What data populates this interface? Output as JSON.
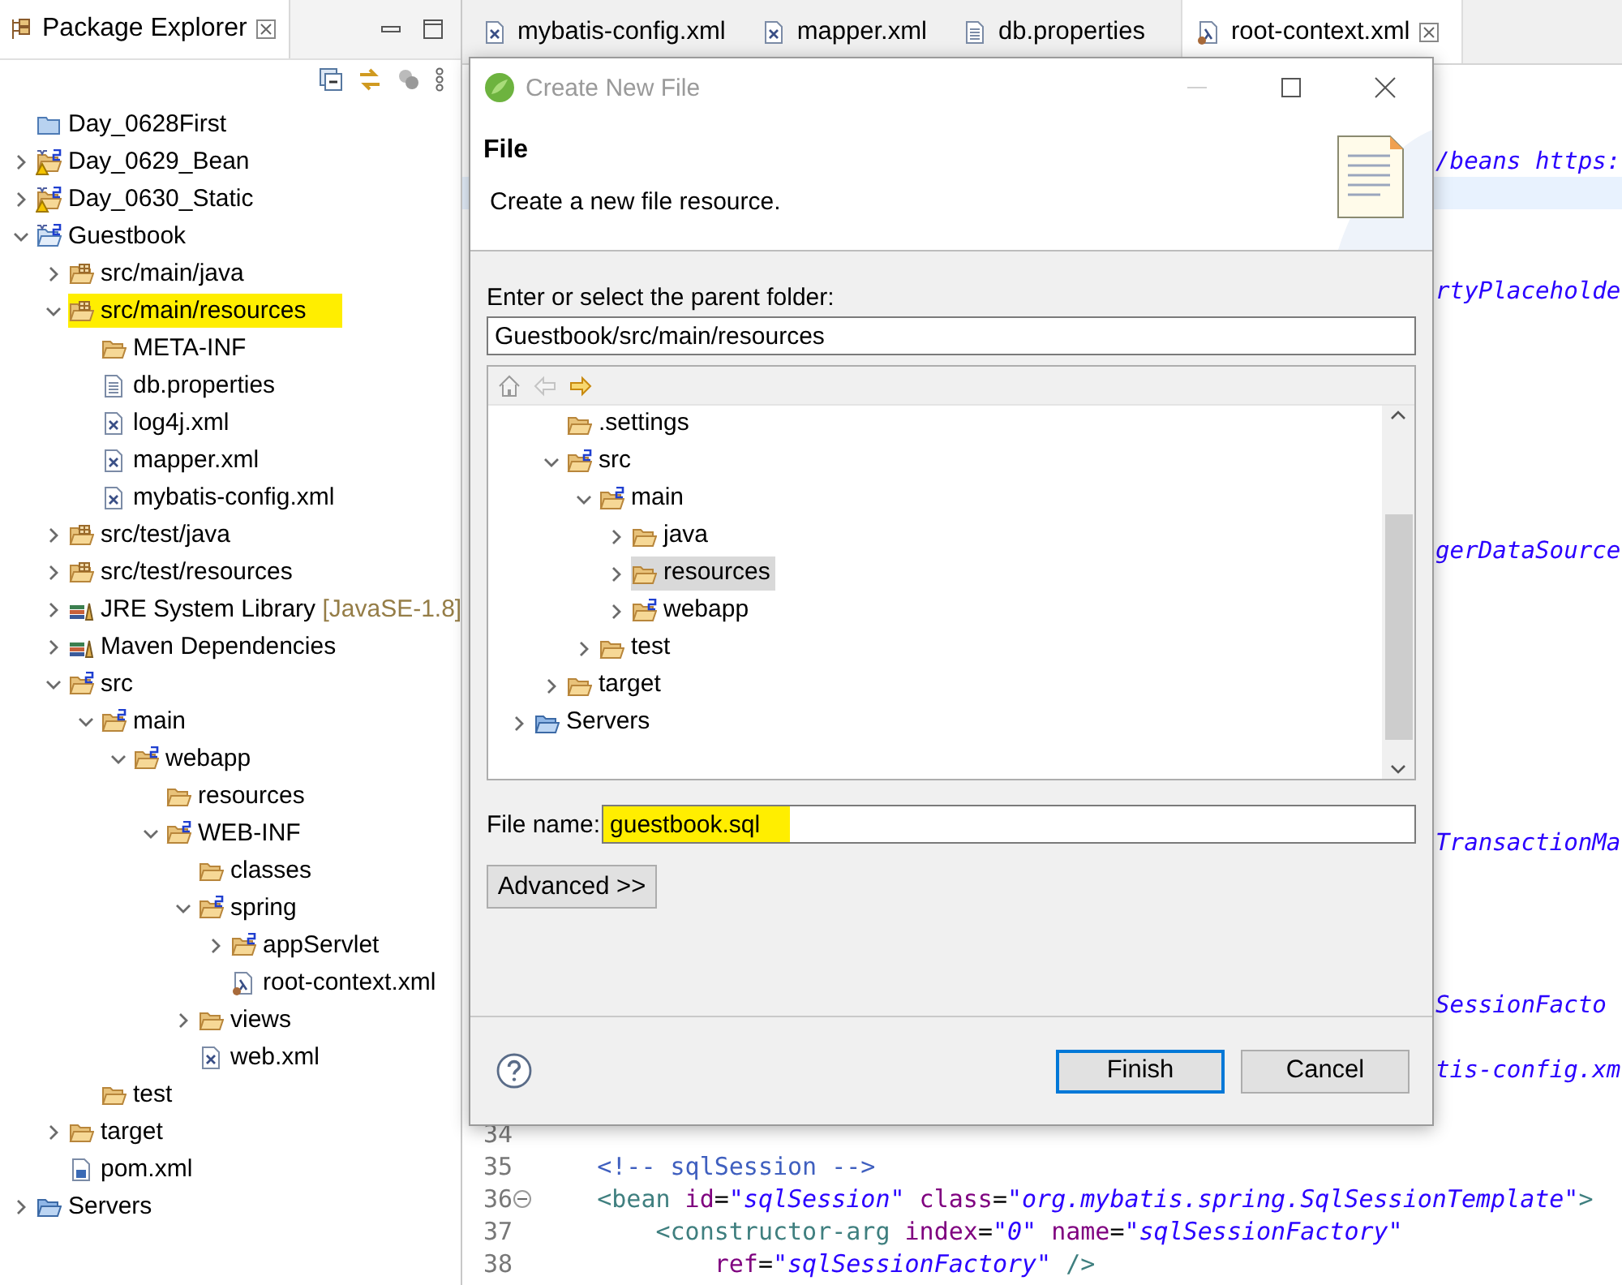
{
  "explorer": {
    "title": "Package Explorer",
    "items": [
      {
        "label": "Day_0628First",
        "kind": "project",
        "selected": false,
        "highlighted": false
      },
      {
        "label": "Day_0629_Bean",
        "kind": "maven-warn",
        "expanded": false,
        "selected": false,
        "highlighted": false
      },
      {
        "label": "Day_0630_Static",
        "kind": "maven-warn",
        "expanded": false,
        "selected": false,
        "highlighted": false
      },
      {
        "label": "Guestbook",
        "kind": "maven",
        "expanded": true,
        "selected": false,
        "highlighted": false,
        "children": [
          {
            "label": "src/main/java",
            "kind": "source-folder",
            "expanded": false,
            "selected": false,
            "highlighted": false
          },
          {
            "label": "src/main/resources",
            "kind": "source-folder",
            "expanded": true,
            "selected": true,
            "highlighted": true,
            "children": [
              {
                "label": "META-INF",
                "kind": "folder",
                "selected": false,
                "highlighted": false
              },
              {
                "label": "db.properties",
                "kind": "file",
                "selected": false,
                "highlighted": false
              },
              {
                "label": "log4j.xml",
                "kind": "xml",
                "selected": false,
                "highlighted": false
              },
              {
                "label": "mapper.xml",
                "kind": "xml",
                "selected": false,
                "highlighted": false
              },
              {
                "label": "mybatis-config.xml",
                "kind": "xml",
                "selected": false,
                "highlighted": false
              }
            ]
          },
          {
            "label": "src/test/java",
            "kind": "source-folder",
            "expanded": false,
            "selected": false,
            "highlighted": false
          },
          {
            "label": "src/test/resources",
            "kind": "source-folder",
            "expanded": false,
            "selected": false,
            "highlighted": false
          },
          {
            "label": "JRE System Library",
            "decoration": "[JavaSE-1.8]",
            "kind": "library",
            "expanded": false,
            "selected": false,
            "highlighted": false
          },
          {
            "label": "Maven Dependencies",
            "kind": "library",
            "expanded": false,
            "selected": false,
            "highlighted": false
          },
          {
            "label": "src",
            "kind": "spring-folder",
            "expanded": true,
            "selected": false,
            "highlighted": false,
            "children": [
              {
                "label": "main",
                "kind": "spring-folder",
                "expanded": true,
                "selected": false,
                "highlighted": false,
                "children": [
                  {
                    "label": "webapp",
                    "kind": "spring-folder",
                    "expanded": true,
                    "selected": false,
                    "highlighted": false,
                    "children": [
                      {
                        "label": "resources",
                        "kind": "folder",
                        "selected": false,
                        "highlighted": false
                      },
                      {
                        "label": "WEB-INF",
                        "kind": "spring-folder",
                        "expanded": true,
                        "selected": false,
                        "highlighted": false,
                        "children": [
                          {
                            "label": "classes",
                            "kind": "folder",
                            "selected": false,
                            "highlighted": false
                          },
                          {
                            "label": "spring",
                            "kind": "spring-folder",
                            "expanded": true,
                            "selected": false,
                            "highlighted": false,
                            "children": [
                              {
                                "label": "appServlet",
                                "kind": "spring-folder",
                                "expanded": false,
                                "selected": false,
                                "highlighted": false
                              },
                              {
                                "label": "root-context.xml",
                                "kind": "spring-xml",
                                "selected": false,
                                "highlighted": false
                              }
                            ]
                          },
                          {
                            "label": "views",
                            "kind": "folder",
                            "expanded": false,
                            "selected": false,
                            "highlighted": false
                          },
                          {
                            "label": "web.xml",
                            "kind": "xml",
                            "selected": false,
                            "highlighted": false
                          }
                        ]
                      }
                    ]
                  }
                ]
              },
              {
                "label": "test",
                "kind": "folder",
                "selected": false,
                "highlighted": false
              }
            ]
          },
          {
            "label": "target",
            "kind": "folder",
            "expanded": false,
            "selected": false,
            "highlighted": false
          },
          {
            "label": "pom.xml",
            "kind": "pom",
            "selected": false,
            "highlighted": false
          }
        ]
      },
      {
        "label": "Servers",
        "kind": "server-folder",
        "expanded": false,
        "selected": false,
        "highlighted": false
      }
    ]
  },
  "editor": {
    "tabs": [
      {
        "label": "mybatis-config.xml",
        "kind": "xml",
        "selected": false
      },
      {
        "label": "mapper.xml",
        "kind": "xml",
        "selected": false
      },
      {
        "label": "db.properties",
        "kind": "file",
        "selected": false
      },
      {
        "label": "root-context.xml",
        "kind": "spring-xml",
        "selected": true
      }
    ],
    "lines": [
      {
        "text": "/beans https:",
        "current": false
      },
      {
        "current": true
      },
      {
        "text": "rtyPlaceholde",
        "current": false
      },
      {
        "text": "gerDataSource",
        "current": false
      },
      {
        "text": "TransactionMa",
        "current": false
      },
      {
        "text": "SessionFacto",
        "current": false
      },
      {
        "text": "tis-config.xm",
        "current": false
      },
      {
        "number": "34",
        "current": false
      },
      {
        "number": "35",
        "current": false,
        "segments": [
          {
            "kind": "comment",
            "text": "    <!-- sqlSession -->"
          }
        ]
      },
      {
        "number": "36",
        "current": false,
        "folded": false,
        "segments": [
          {
            "kind": "tag",
            "text": "    <bean"
          },
          {
            "kind": "attr",
            "text": " id"
          },
          {
            "kind": "plain",
            "text": "="
          },
          {
            "kind": "value",
            "text": "\"sqlSession\""
          },
          {
            "kind": "attr",
            "text": " class"
          },
          {
            "kind": "plain",
            "text": "="
          },
          {
            "kind": "value",
            "text": "\"org.mybatis.spring.SqlSessionTemplate\""
          },
          {
            "kind": "tag",
            "text": ">"
          }
        ]
      },
      {
        "number": "37",
        "current": false,
        "segments": [
          {
            "kind": "tag",
            "text": "        <constructor-arg"
          },
          {
            "kind": "attr",
            "text": " index"
          },
          {
            "kind": "plain",
            "text": "="
          },
          {
            "kind": "value",
            "text": "\"0\""
          },
          {
            "kind": "attr",
            "text": " name"
          },
          {
            "kind": "plain",
            "text": "="
          },
          {
            "kind": "value",
            "text": "\"sqlSessionFactory\""
          }
        ]
      },
      {
        "number": "38",
        "current": false,
        "segments": [
          {
            "kind": "attr",
            "text": "            ref"
          },
          {
            "kind": "plain",
            "text": "="
          },
          {
            "kind": "value",
            "text": "\"sqlSessionFactory\""
          },
          {
            "kind": "tag",
            "text": " />"
          }
        ]
      }
    ]
  },
  "dialog": {
    "title": "Create New File",
    "heading": "File",
    "description": "Create a new file resource.",
    "folder_label": "Enter or select the parent folder:",
    "folder_value": "Guestbook/src/main/resources",
    "tree": [
      {
        "children": [
          {
            "label": ".settings",
            "kind": "folder",
            "selected": false
          },
          {
            "label": "src",
            "kind": "spring-folder",
            "expanded": true,
            "selected": false,
            "children": [
              {
                "label": "main",
                "kind": "spring-folder",
                "expanded": true,
                "selected": false,
                "children": [
                  {
                    "label": "java",
                    "kind": "folder",
                    "expanded": false,
                    "selected": false
                  },
                  {
                    "label": "resources",
                    "kind": "folder",
                    "expanded": false,
                    "selected": true
                  },
                  {
                    "label": "webapp",
                    "kind": "spring-folder",
                    "expanded": false,
                    "selected": false
                  }
                ]
              },
              {
                "label": "test",
                "kind": "folder",
                "expanded": false,
                "selected": false
              }
            ]
          },
          {
            "label": "target",
            "kind": "folder",
            "expanded": false,
            "selected": false
          }
        ]
      },
      {
        "label": "Servers",
        "kind": "server-folder",
        "expanded": false,
        "selected": false
      }
    ],
    "file_name_label": "File name:",
    "file_name_value": "guestbook.sql",
    "file_name_highlighted": true,
    "advanced_button": "Advanced >>",
    "buttons": [
      {
        "label": "Finish",
        "default": true
      },
      {
        "label": "Cancel",
        "default": false
      }
    ]
  }
}
